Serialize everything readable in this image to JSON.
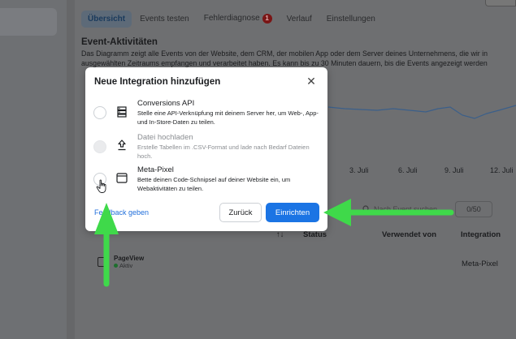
{
  "tabs": [
    {
      "label": "Übersicht",
      "active": true
    },
    {
      "label": "Events testen",
      "active": false
    },
    {
      "label": "Fehlerdiagnose",
      "active": false,
      "badge": "1"
    },
    {
      "label": "Verlauf",
      "active": false
    },
    {
      "label": "Einstellungen",
      "active": false
    }
  ],
  "section": {
    "title": "Event-Aktivitäten",
    "desc_line1": "Das Diagramm zeigt alle Events von der Website, dem CRM, der mobilen App oder dem Server deines Unternehmens, die wir in",
    "desc_line2": "ausgewählten Zeitraums empfangen und verarbeitet haben. Es kann bis zu 30 Minuten dauern, bis die Events angezeigt werden"
  },
  "chart": {
    "x_labels": [
      "3. Juli",
      "6. Juli",
      "9. Juli",
      "12. Juli"
    ]
  },
  "search": {
    "placeholder": "Nach Event suchen",
    "count": "0/50"
  },
  "table": {
    "headers": [
      "Status",
      "Verwendet von",
      "Integration"
    ],
    "rows": [
      {
        "event": "PageView",
        "status": "Aktiv",
        "used_by": "Meta-Pixel"
      }
    ]
  },
  "modal": {
    "title": "Neue Integration hinzufügen",
    "options": [
      {
        "title": "Conversions API",
        "desc": "Stelle eine API-Verknüpfung mit deinem Server her, um Web-, App- und In-Store-Daten zu teilen.",
        "icon": "server-icon",
        "disabled": false
      },
      {
        "title": "Datei hochladen",
        "desc": "Erstelle Tabellen im .CSV-Format und lade nach Bedarf Dateien hoch.",
        "icon": "upload-icon",
        "disabled": true
      },
      {
        "title": "Meta-Pixel",
        "desc": "Bette deinen Code-Schnipsel auf deiner Website ein, um Webaktivitäten zu teilen.",
        "icon": "browser-window-icon",
        "disabled": false
      }
    ],
    "feedback": "Feedback geben",
    "back": "Zurück",
    "setup": "Einrichten"
  },
  "colors": {
    "primary_button": "#1b74e4",
    "link": "#216fdb",
    "annotation_arrow": "#3fd94a"
  }
}
